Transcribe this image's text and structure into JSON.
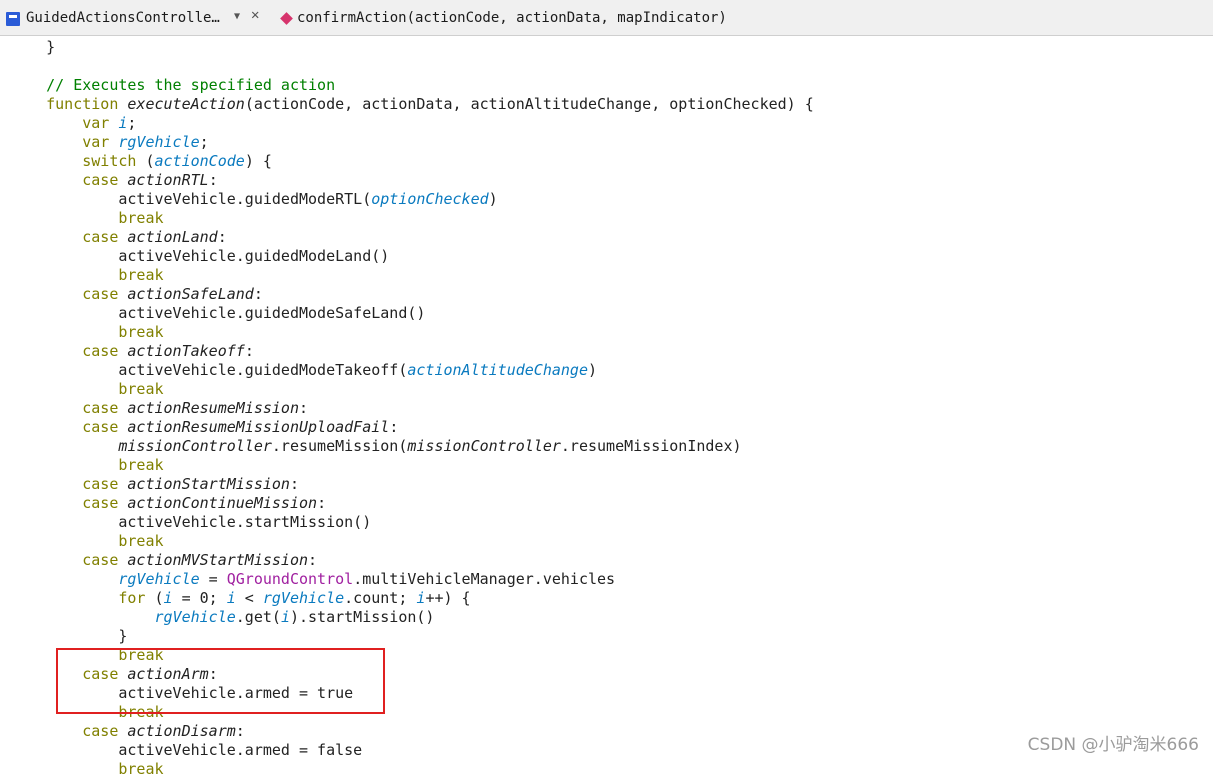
{
  "toolbar": {
    "file_name": "GuidedActionsControlle…",
    "dropdown_glyph": "▼",
    "close_glyph": "✕",
    "function_signature": "confirmAction(actionCode, actionData, mapIndicator)"
  },
  "colors": {
    "keyword": "#808000",
    "comment": "#008000",
    "italic_identifier": "#222222",
    "parameter": "#0a7abf",
    "type": "#a020a0",
    "default": "#222222",
    "highlight": "#e02020"
  },
  "code_lines": [
    [
      {
        "t": "    }",
        "c": "default"
      }
    ],
    [],
    [
      {
        "t": "    // Executes the specified action",
        "c": "comment"
      }
    ],
    [
      {
        "t": "    ",
        "c": "default"
      },
      {
        "t": "function",
        "c": "keyword"
      },
      {
        "t": " ",
        "c": "default"
      },
      {
        "t": "executeAction",
        "c": "italic"
      },
      {
        "t": "(actionCode, actionData, actionAltitudeChange, optionChecked) {",
        "c": "default"
      }
    ],
    [
      {
        "t": "        ",
        "c": "default"
      },
      {
        "t": "var",
        "c": "keyword"
      },
      {
        "t": " ",
        "c": "default"
      },
      {
        "t": "i",
        "c": "param"
      },
      {
        "t": ";",
        "c": "default"
      }
    ],
    [
      {
        "t": "        ",
        "c": "default"
      },
      {
        "t": "var",
        "c": "keyword"
      },
      {
        "t": " ",
        "c": "default"
      },
      {
        "t": "rgVehicle",
        "c": "param"
      },
      {
        "t": ";",
        "c": "default"
      }
    ],
    [
      {
        "t": "        ",
        "c": "default"
      },
      {
        "t": "switch",
        "c": "keyword"
      },
      {
        "t": " (",
        "c": "default"
      },
      {
        "t": "actionCode",
        "c": "param"
      },
      {
        "t": ") {",
        "c": "default"
      }
    ],
    [
      {
        "t": "        ",
        "c": "default"
      },
      {
        "t": "case",
        "c": "keyword"
      },
      {
        "t": " ",
        "c": "default"
      },
      {
        "t": "actionRTL",
        "c": "italic"
      },
      {
        "t": ":",
        "c": "default"
      }
    ],
    [
      {
        "t": "            activeVehicle.guidedModeRTL(",
        "c": "default"
      },
      {
        "t": "optionChecked",
        "c": "param"
      },
      {
        "t": ")",
        "c": "default"
      }
    ],
    [
      {
        "t": "            ",
        "c": "default"
      },
      {
        "t": "break",
        "c": "keyword"
      }
    ],
    [
      {
        "t": "        ",
        "c": "default"
      },
      {
        "t": "case",
        "c": "keyword"
      },
      {
        "t": " ",
        "c": "default"
      },
      {
        "t": "actionLand",
        "c": "italic"
      },
      {
        "t": ":",
        "c": "default"
      }
    ],
    [
      {
        "t": "            activeVehicle.guidedModeLand()",
        "c": "default"
      }
    ],
    [
      {
        "t": "            ",
        "c": "default"
      },
      {
        "t": "break",
        "c": "keyword"
      }
    ],
    [
      {
        "t": "        ",
        "c": "default"
      },
      {
        "t": "case",
        "c": "keyword"
      },
      {
        "t": " ",
        "c": "default"
      },
      {
        "t": "actionSafeLand",
        "c": "italic"
      },
      {
        "t": ":",
        "c": "default"
      }
    ],
    [
      {
        "t": "            activeVehicle.guidedModeSafeLand()",
        "c": "default"
      }
    ],
    [
      {
        "t": "            ",
        "c": "default"
      },
      {
        "t": "break",
        "c": "keyword"
      }
    ],
    [
      {
        "t": "        ",
        "c": "default"
      },
      {
        "t": "case",
        "c": "keyword"
      },
      {
        "t": " ",
        "c": "default"
      },
      {
        "t": "actionTakeoff",
        "c": "italic"
      },
      {
        "t": ":",
        "c": "default"
      }
    ],
    [
      {
        "t": "            activeVehicle.guidedModeTakeoff(",
        "c": "default"
      },
      {
        "t": "actionAltitudeChange",
        "c": "param"
      },
      {
        "t": ")",
        "c": "default"
      }
    ],
    [
      {
        "t": "            ",
        "c": "default"
      },
      {
        "t": "break",
        "c": "keyword"
      }
    ],
    [
      {
        "t": "        ",
        "c": "default"
      },
      {
        "t": "case",
        "c": "keyword"
      },
      {
        "t": " ",
        "c": "default"
      },
      {
        "t": "actionResumeMission",
        "c": "italic"
      },
      {
        "t": ":",
        "c": "default"
      }
    ],
    [
      {
        "t": "        ",
        "c": "default"
      },
      {
        "t": "case",
        "c": "keyword"
      },
      {
        "t": " ",
        "c": "default"
      },
      {
        "t": "actionResumeMissionUploadFail",
        "c": "italic"
      },
      {
        "t": ":",
        "c": "default"
      }
    ],
    [
      {
        "t": "            ",
        "c": "default"
      },
      {
        "t": "missionController",
        "c": "italic"
      },
      {
        "t": ".resumeMission(",
        "c": "default"
      },
      {
        "t": "missionController",
        "c": "italic"
      },
      {
        "t": ".resumeMissionIndex)",
        "c": "default"
      }
    ],
    [
      {
        "t": "            ",
        "c": "default"
      },
      {
        "t": "break",
        "c": "keyword"
      }
    ],
    [
      {
        "t": "        ",
        "c": "default"
      },
      {
        "t": "case",
        "c": "keyword"
      },
      {
        "t": " ",
        "c": "default"
      },
      {
        "t": "actionStartMission",
        "c": "italic"
      },
      {
        "t": ":",
        "c": "default"
      }
    ],
    [
      {
        "t": "        ",
        "c": "default"
      },
      {
        "t": "case",
        "c": "keyword"
      },
      {
        "t": " ",
        "c": "default"
      },
      {
        "t": "actionContinueMission",
        "c": "italic"
      },
      {
        "t": ":",
        "c": "default"
      }
    ],
    [
      {
        "t": "            activeVehicle.startMission()",
        "c": "default"
      }
    ],
    [
      {
        "t": "            ",
        "c": "default"
      },
      {
        "t": "break",
        "c": "keyword"
      }
    ],
    [
      {
        "t": "        ",
        "c": "default"
      },
      {
        "t": "case",
        "c": "keyword"
      },
      {
        "t": " ",
        "c": "default"
      },
      {
        "t": "actionMVStartMission",
        "c": "italic"
      },
      {
        "t": ":",
        "c": "default"
      }
    ],
    [
      {
        "t": "            ",
        "c": "default"
      },
      {
        "t": "rgVehicle",
        "c": "param"
      },
      {
        "t": " = ",
        "c": "default"
      },
      {
        "t": "QGroundControl",
        "c": "type"
      },
      {
        "t": ".multiVehicleManager.vehicles",
        "c": "default"
      }
    ],
    [
      {
        "t": "            ",
        "c": "default"
      },
      {
        "t": "for",
        "c": "keyword"
      },
      {
        "t": " (",
        "c": "default"
      },
      {
        "t": "i",
        "c": "param"
      },
      {
        "t": " = 0; ",
        "c": "default"
      },
      {
        "t": "i",
        "c": "param"
      },
      {
        "t": " < ",
        "c": "default"
      },
      {
        "t": "rgVehicle",
        "c": "param"
      },
      {
        "t": ".count; ",
        "c": "default"
      },
      {
        "t": "i",
        "c": "param"
      },
      {
        "t": "++) {",
        "c": "default"
      }
    ],
    [
      {
        "t": "                ",
        "c": "default"
      },
      {
        "t": "rgVehicle",
        "c": "param"
      },
      {
        "t": ".get(",
        "c": "default"
      },
      {
        "t": "i",
        "c": "param"
      },
      {
        "t": ").startMission()",
        "c": "default"
      }
    ],
    [
      {
        "t": "            }",
        "c": "default"
      }
    ],
    [
      {
        "t": "            ",
        "c": "default"
      },
      {
        "t": "break",
        "c": "keyword"
      }
    ],
    [
      {
        "t": "        ",
        "c": "default"
      },
      {
        "t": "case",
        "c": "keyword"
      },
      {
        "t": " ",
        "c": "default"
      },
      {
        "t": "actionArm",
        "c": "italic"
      },
      {
        "t": ":",
        "c": "default"
      }
    ],
    [
      {
        "t": "            activeVehicle.armed = true",
        "c": "default"
      }
    ],
    [
      {
        "t": "            ",
        "c": "default"
      },
      {
        "t": "break",
        "c": "keyword"
      }
    ],
    [
      {
        "t": "        ",
        "c": "default"
      },
      {
        "t": "case",
        "c": "keyword"
      },
      {
        "t": " ",
        "c": "default"
      },
      {
        "t": "actionDisarm",
        "c": "italic"
      },
      {
        "t": ":",
        "c": "default"
      }
    ],
    [
      {
        "t": "            activeVehicle.armed = false",
        "c": "default"
      }
    ],
    [
      {
        "t": "            ",
        "c": "default"
      },
      {
        "t": "break",
        "c": "keyword"
      }
    ]
  ],
  "watermark": "CSDN @小驴淘米666"
}
